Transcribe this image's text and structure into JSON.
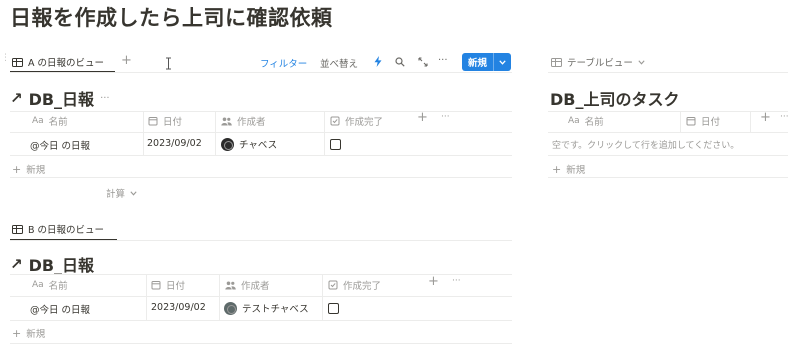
{
  "page": {
    "title": "日報を作成したら上司に確認依頼"
  },
  "toolbar": {
    "filter_label": "フィルター",
    "sort_label": "並べ替え",
    "new_label": "新規"
  },
  "view_a": {
    "tab_label": "A の日報のビュー",
    "db_title": "DB_日報",
    "columns": {
      "name": "名前",
      "date": "日付",
      "author": "作成者",
      "done": "作成完了"
    },
    "row": {
      "name": "@今日 の日報",
      "date": "2023/09/02",
      "author": "チャベス"
    },
    "new_row_label": "新規",
    "calc_label": "計算"
  },
  "view_b": {
    "tab_label": "B の日報のビュー",
    "db_title": "DB_日報",
    "columns": {
      "name": "名前",
      "date": "日付",
      "author": "作成者",
      "done": "作成完了"
    },
    "row": {
      "name": "@今日 の日報",
      "date": "2023/09/02",
      "author": "テストチャベス"
    },
    "new_row_label": "新規"
  },
  "view_c": {
    "tab_label": "テーブルビュー",
    "db_title": "DB_上司のタスク",
    "columns": {
      "name": "名前",
      "date": "日付"
    },
    "empty_text": "空です。クリックして行を追加してください。",
    "new_row_label": "新規"
  },
  "glyphs": {
    "plus": "+",
    "more": "···",
    "arrow": "↗",
    "aa": "Aa",
    "chevron": "⌄"
  }
}
